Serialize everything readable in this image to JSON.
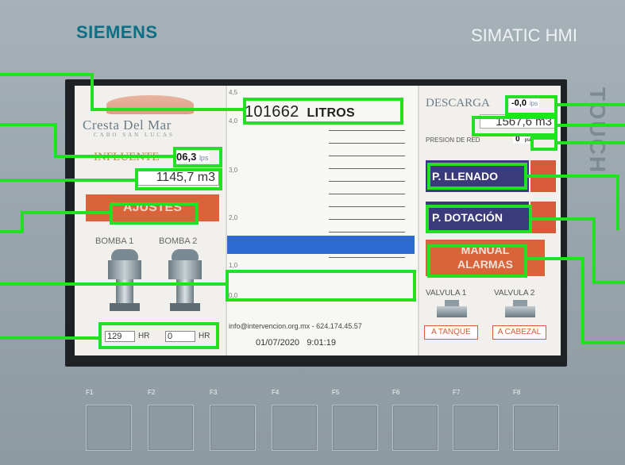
{
  "device": {
    "brand": "SIEMENS",
    "model": "SIMATIC HMI",
    "side_label": "TOUCH"
  },
  "left_panel": {
    "logo_title": "Cresta Del Mar",
    "logo_subtitle": "CABO SAN LUCAS",
    "influente_label": "INFLUENTE",
    "influente_value": "06,3",
    "influente_unit": "lps",
    "accum_value": "1145,7 m3",
    "ajustes_label": "AJUSTES",
    "bomba1_label": "BOMBA 1",
    "bomba2_label": "BOMBA 2",
    "bomba1_hours": "129",
    "bomba2_hours": "0",
    "hr_label": "HR"
  },
  "center_panel": {
    "tick_top": "4,5",
    "tick_4": "4,0",
    "tick_3": "3,0",
    "tick_2": "2,0",
    "tick_1": "1,0",
    "tick_0": "0,0",
    "level_value": "101662",
    "level_unit": "LITROS",
    "level_fraction": 0.06,
    "contact": "info@intervencion.org.mx - 624.174.45.57",
    "date": "01/07/2020",
    "time": "9:01:19"
  },
  "right_panel": {
    "descarga_label": "DESCARGA",
    "descarga_value": "-0,0",
    "descarga_unit": "lps",
    "descarga_accum": "1567,6 m3",
    "presion_label": "PRESION DE RED",
    "presion_value": "0",
    "presion_unit": "psi",
    "p_llenado": "P. LLENADO",
    "p_dotacion": "P. DOTACIÓN",
    "manual_alarmas_1": "MANUAL",
    "manual_alarmas_2": "ALARMAS",
    "valvula1_label": "VALVULA 1",
    "valvula2_label": "VALVULA 2",
    "valvula1_status": "A TANQUE",
    "valvula2_status": "A CABEZAL"
  },
  "function_keys": [
    "F1",
    "F2",
    "F3",
    "F4",
    "F5",
    "F6",
    "F7",
    "F8"
  ],
  "colors": {
    "highlight": "#22e022",
    "accent_orange": "#d9643a",
    "accent_purple": "#3b3a7a",
    "water": "#2e6bd1"
  }
}
